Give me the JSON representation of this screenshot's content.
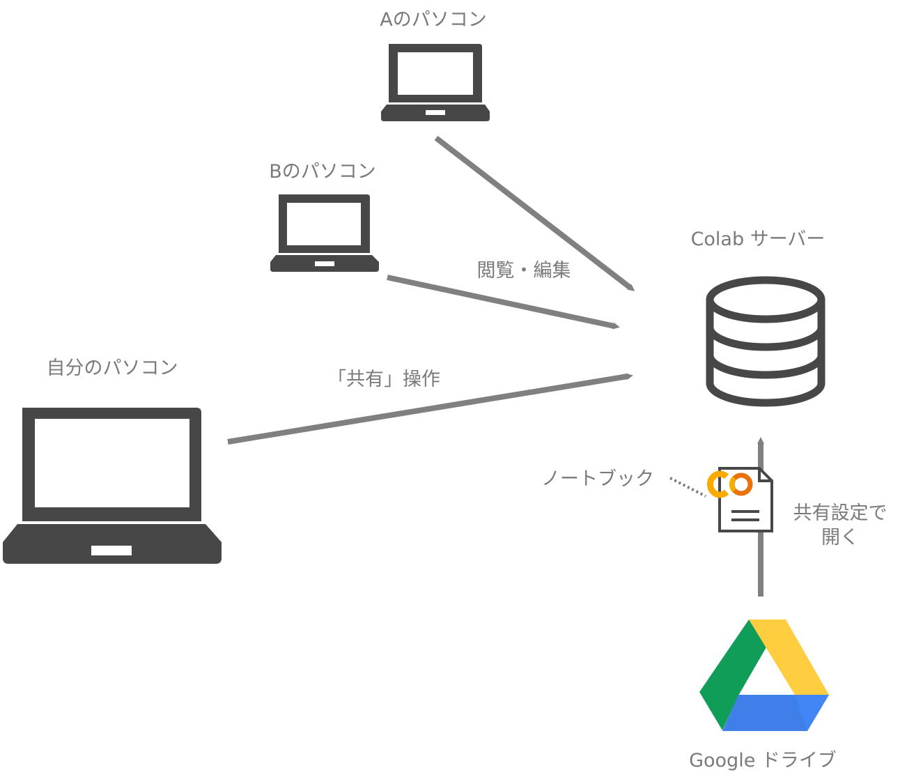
{
  "labels": {
    "pc_a": "Aのパソコン",
    "pc_b": "Bのパソコン",
    "pc_self": "自分のパソコン",
    "server": "Colab サーバー",
    "view_edit": "閲覧・編集",
    "share_op": "「共有」操作",
    "notebook": "ノートブック",
    "open_share_line1": "共有設定で",
    "open_share_line2": "開く",
    "drive": "Google ドライブ",
    "colab_logo_text": "CO"
  },
  "colors": {
    "icon": "#474747",
    "arrow": "#808080",
    "text": "#7a7a7a",
    "colab_yellow": "#f9ab00",
    "colab_orange": "#e8710a",
    "drive_green": "#0f9d58",
    "drive_yellow": "#ffcd40",
    "drive_blue": "#4285f4"
  },
  "icons": {
    "laptops": [
      "laptop-icon-a",
      "laptop-icon-b",
      "laptop-icon-self"
    ],
    "server": "database-icon",
    "notebook": "colab-document-icon",
    "drive": "google-drive-icon"
  }
}
